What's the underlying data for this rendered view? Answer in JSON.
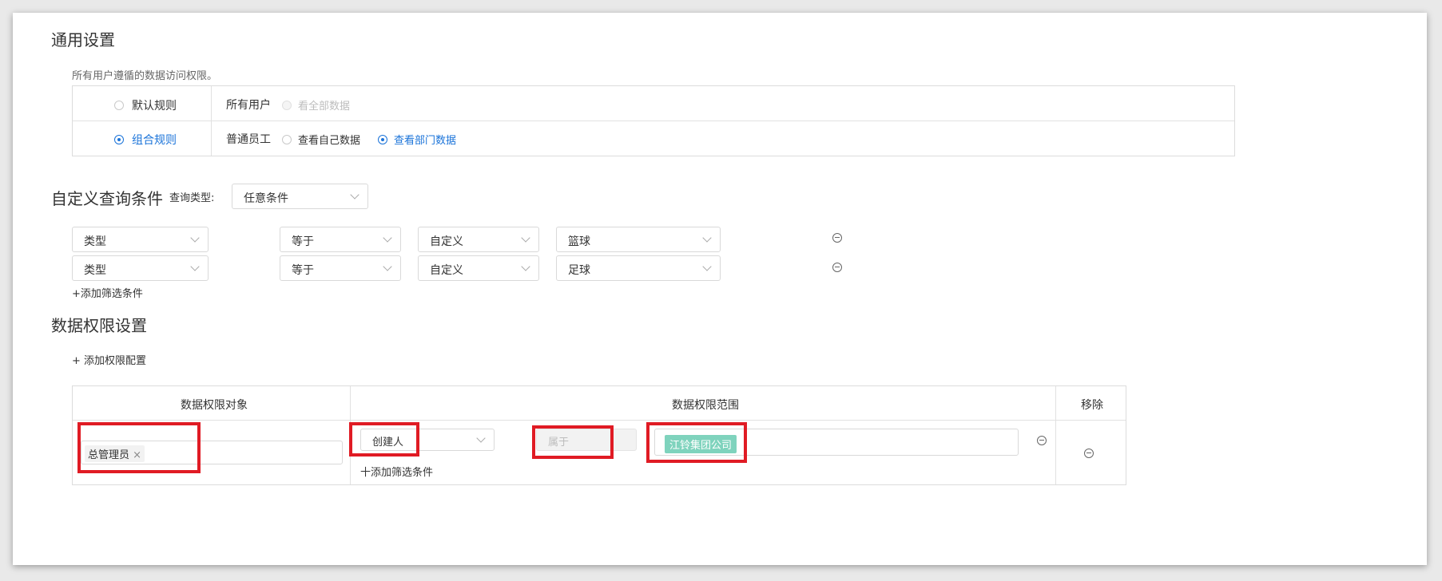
{
  "general": {
    "title": "通用设置",
    "description": "所有用户遵循的数据访问权限。",
    "rules": [
      {
        "rule_label": "默认规则",
        "checked": false,
        "user_label": "所有用户",
        "options": [
          {
            "label": "看全部数据",
            "checked": false,
            "disabled": true
          }
        ]
      },
      {
        "rule_label": "组合规则",
        "checked": true,
        "user_label": "普通员工",
        "options": [
          {
            "label": "查看自己数据",
            "checked": false
          },
          {
            "label": "查看部门数据",
            "checked": true
          }
        ]
      }
    ]
  },
  "custom_query": {
    "title": "自定义查询条件",
    "type_label": "查询类型:",
    "type_value": "任意条件",
    "conditions": [
      {
        "field": "类型",
        "operator": "等于",
        "mode": "自定义",
        "value": "篮球"
      },
      {
        "field": "类型",
        "operator": "等于",
        "mode": "自定义",
        "value": "足球"
      }
    ],
    "add_filter": "+添加筛选条件"
  },
  "permission": {
    "title": "数据权限设置",
    "add_config": "+ 添加权限配置",
    "columns": [
      "数据权限对象",
      "数据权限范围",
      "移除"
    ],
    "row": {
      "object_tag": "总管理员",
      "tag_close": "×",
      "field": "创建人",
      "operator_placeholder": "属于",
      "scope_tag": "江铃集团公司",
      "add_filter": "十添加筛选条件"
    }
  },
  "colors": {
    "accent": "#1a73d9",
    "highlight": "#e01b24",
    "tag_green": "#7fd3bd"
  }
}
